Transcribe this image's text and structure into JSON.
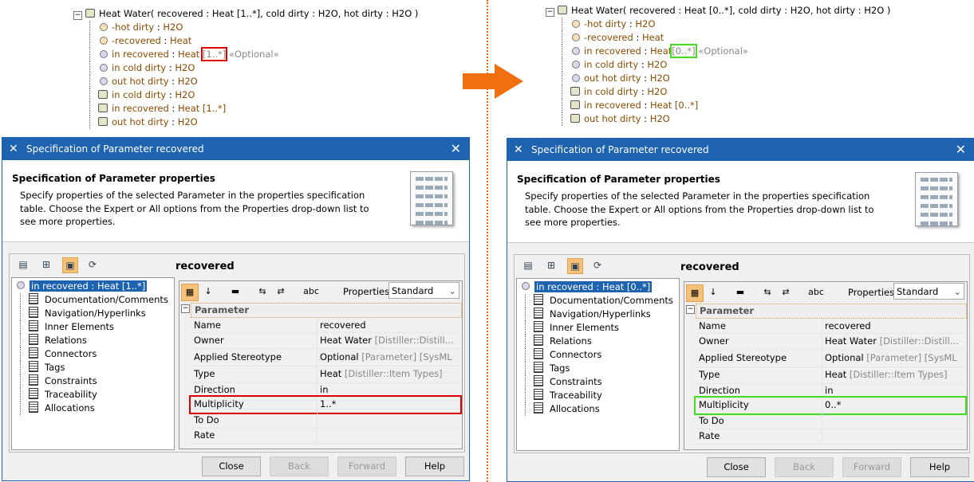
{
  "arrow_color": "#f07010",
  "sides": [
    {
      "key": "before",
      "highlight_color": "#e00000",
      "tree": {
        "root": "Heat Water( recovered : Heat [1..*], cold dirty : H2O, hot dirty : H2O )",
        "items": [
          {
            "icon": "property-icon",
            "name": "-hot dirty",
            "sep": " : ",
            "type": "H2O",
            "mult": "",
            "stereo": ""
          },
          {
            "icon": "property-icon",
            "name": "-recovered",
            "sep": " : ",
            "type": "Heat",
            "mult": "",
            "stereo": ""
          },
          {
            "icon": "warning-parameter-icon",
            "name": "in recovered",
            "sep": " : ",
            "type": "Heat ",
            "mult": "[1..*]",
            "stereo": " «Optional»",
            "hl": true
          },
          {
            "icon": "parameter-icon",
            "name": "in cold dirty",
            "sep": " : ",
            "type": "H2O",
            "mult": "",
            "stereo": ""
          },
          {
            "icon": "parameter-icon",
            "name": "out hot dirty",
            "sep": " : ",
            "type": "H2O",
            "mult": "",
            "stereo": ""
          },
          {
            "icon": "port-icon",
            "name": "in cold dirty",
            "sep": " : ",
            "type": "H2O",
            "mult": "",
            "stereo": ""
          },
          {
            "icon": "port-icon",
            "name": "in recovered",
            "sep": " : ",
            "type": "Heat [1..*]",
            "mult": "",
            "stereo": ""
          },
          {
            "icon": "port-icon",
            "name": "out hot dirty",
            "sep": " : ",
            "type": "H2O",
            "mult": "",
            "stereo": ""
          }
        ]
      },
      "dialog": {
        "title": "Specification of Parameter recovered",
        "close": "✕",
        "header_title": "Specification of Parameter properties",
        "header_text": "Specify properties of the selected Parameter in the properties specification table. Choose the Expert or All options from the Properties drop-down list to see more properties.",
        "element_name": "recovered",
        "nav_selected": "in recovered : Heat [1..*]",
        "nav_items": [
          "Documentation/Comments",
          "Navigation/Hyperlinks",
          "Inner Elements",
          "Relations",
          "Connectors",
          "Tags",
          "Constraints",
          "Traceability",
          "Allocations"
        ],
        "properties_label": "Properties:",
        "properties_value": "Standard",
        "category": "Parameter",
        "rows": [
          {
            "k": "Name",
            "v": "recovered",
            "g": ""
          },
          {
            "k": "Owner",
            "v": "Heat Water",
            "g": " [Distiller::Distill..."
          },
          {
            "k": "Applied Stereotype",
            "v": "Optional",
            "g": " [Parameter] [SysML"
          },
          {
            "k": "Type",
            "v": "Heat",
            "g": " [Distiller::Item Types]"
          },
          {
            "k": "Direction",
            "v": "in",
            "g": ""
          },
          {
            "k": "Multiplicity",
            "v": "1..*",
            "g": "",
            "hl": true
          },
          {
            "k": "To Do",
            "v": "",
            "g": ""
          },
          {
            "k": "Rate",
            "v": "",
            "g": ""
          }
        ],
        "buttons": [
          "Close",
          "Back",
          "Forward",
          "Help"
        ]
      }
    },
    {
      "key": "after",
      "highlight_color": "#44dd22",
      "tree": {
        "root": "Heat Water( recovered : Heat [0..*], cold dirty : H2O, hot dirty : H2O )",
        "items": [
          {
            "icon": "property-icon",
            "name": "-hot dirty",
            "sep": " : ",
            "type": "H2O",
            "mult": "",
            "stereo": ""
          },
          {
            "icon": "property-icon",
            "name": "-recovered",
            "sep": " : ",
            "type": "Heat",
            "mult": "",
            "stereo": ""
          },
          {
            "icon": "parameter-icon",
            "name": "in recovered",
            "sep": " : ",
            "type": "Heat",
            "mult": "[0..*]",
            "stereo": " «Optional»",
            "hl": true
          },
          {
            "icon": "parameter-icon",
            "name": "in cold dirty",
            "sep": " : ",
            "type": "H2O",
            "mult": "",
            "stereo": ""
          },
          {
            "icon": "parameter-icon",
            "name": "out hot dirty",
            "sep": " : ",
            "type": "H2O",
            "mult": "",
            "stereo": ""
          },
          {
            "icon": "port-icon",
            "name": "in cold dirty",
            "sep": " : ",
            "type": "H2O",
            "mult": "",
            "stereo": ""
          },
          {
            "icon": "port-icon",
            "name": "in recovered",
            "sep": " : ",
            "type": "Heat [0..*]",
            "mult": "",
            "stereo": ""
          },
          {
            "icon": "port-icon",
            "name": "out hot dirty",
            "sep": " : ",
            "type": "H2O",
            "mult": "",
            "stereo": ""
          }
        ]
      },
      "dialog": {
        "title": "Specification of Parameter recovered",
        "close": "✕",
        "header_title": "Specification of Parameter properties",
        "header_text": "Specify properties of the selected Parameter in the properties specification table. Choose the Expert or All options from the Properties drop-down list to see more properties.",
        "element_name": "recovered",
        "nav_selected": "in recovered : Heat [0..*]",
        "nav_items": [
          "Documentation/Comments",
          "Navigation/Hyperlinks",
          "Inner Elements",
          "Relations",
          "Connectors",
          "Tags",
          "Constraints",
          "Traceability",
          "Allocations"
        ],
        "properties_label": "Properties:",
        "properties_value": "Standard",
        "category": "Parameter",
        "rows": [
          {
            "k": "Name",
            "v": "recovered",
            "g": ""
          },
          {
            "k": "Owner",
            "v": "Heat Water",
            "g": " [Distiller::Distill..."
          },
          {
            "k": "Applied Stereotype",
            "v": "Optional",
            "g": " [Parameter] [SysML"
          },
          {
            "k": "Type",
            "v": "Heat",
            "g": " [Distiller::Item Types]"
          },
          {
            "k": "Direction",
            "v": "in",
            "g": ""
          },
          {
            "k": "Multiplicity",
            "v": "0..*",
            "g": "",
            "hl": true
          },
          {
            "k": "To Do",
            "v": "",
            "g": ""
          },
          {
            "k": "Rate",
            "v": "",
            "g": ""
          }
        ],
        "buttons": [
          "Close",
          "Back",
          "Forward",
          "Help"
        ]
      }
    }
  ]
}
